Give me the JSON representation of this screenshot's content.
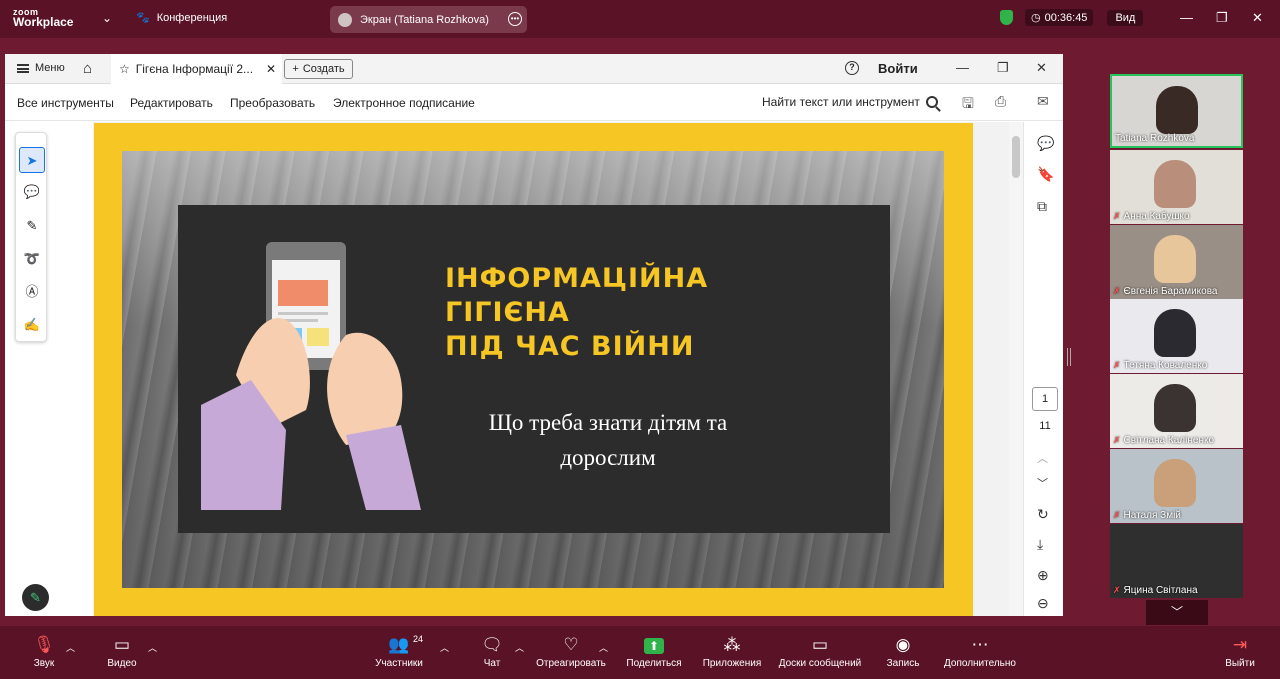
{
  "zoom": {
    "logo_line1": "zoom",
    "logo_line2": "Workplace",
    "meeting_label": "Конференция",
    "share_label": "Экран (Tatiana Rozhkova)",
    "timer": "00:36:45",
    "view_label": "Вид"
  },
  "doc": {
    "menu_label": "Меню",
    "tab_title": "Гігєна Інформації 2...",
    "create_label": "Создать",
    "login_label": "Войти",
    "toolbar": {
      "all_tools": "Все инструменты",
      "edit": "Редактировать",
      "convert": "Преобразовать",
      "esign": "Электронное подписание",
      "find": "Найти текст или инструмент"
    },
    "page_current": "1",
    "page_total": "11"
  },
  "slide": {
    "title_line1": "ІНФОРМАЦІЙНА",
    "title_line2": "ГІГІЄНА",
    "title_line3": "ПІД ЧАС ВІЙНИ",
    "subtitle_line1": "Що треба знати дітям та",
    "subtitle_line2": "дорослим"
  },
  "participants": [
    {
      "name": "Tatiana Rozhkova"
    },
    {
      "name": "Анна Кабушко"
    },
    {
      "name": "Євгенія Барамикова"
    },
    {
      "name": "Тетяна  Коваленко"
    },
    {
      "name": "Світлана Каліненко"
    },
    {
      "name": "Наталя Змій"
    },
    {
      "name": "Яцина Світлана"
    }
  ],
  "toolbar": {
    "audio": "Звук",
    "video": "Видео",
    "participants": "Участники",
    "participants_count": "24",
    "chat": "Чат",
    "react": "Отреагировать",
    "share": "Поделиться",
    "apps": "Приложения",
    "whiteboards": "Доски сообщений",
    "record": "Запись",
    "more": "Дополнительно",
    "leave": "Выйти"
  },
  "colors": {
    "zoom_bg": "#6e1a30",
    "slide_yellow": "#f6c624",
    "slide_dark": "#2c2c2c",
    "active_speaker": "#27c45e",
    "share_green": "#2fb34a"
  }
}
